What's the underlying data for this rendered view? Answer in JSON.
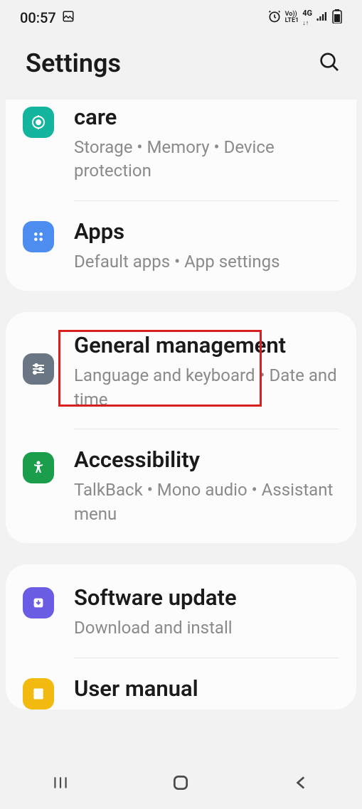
{
  "status_bar": {
    "time": "00:57",
    "icons": {
      "picture": "picture-icon",
      "alarm": "alarm-icon",
      "volte": "Vo))\nLTE1",
      "network": "4G",
      "arrows": "↓↑",
      "signal": "signal-icon",
      "battery": "battery-icon"
    }
  },
  "header": {
    "title": "Settings"
  },
  "groups": [
    {
      "items": [
        {
          "icon": "care-icon",
          "icon_color": "#14b59e",
          "title": "care",
          "subtitle": "Storage  •  Memory  •  Device protection"
        },
        {
          "icon": "apps-icon",
          "icon_color": "#4d8def",
          "title": "Apps",
          "subtitle": "Default apps  •  App settings"
        }
      ]
    },
    {
      "items": [
        {
          "icon": "sliders-icon",
          "icon_color": "#6b7684",
          "title": "General management",
          "subtitle": "Language and keyboard  •  Date and time",
          "highlighted": true
        },
        {
          "icon": "accessibility-icon",
          "icon_color": "#1a9e4b",
          "title": "Accessibility",
          "subtitle": "TalkBack  •  Mono audio  •  Assistant menu"
        }
      ]
    },
    {
      "items": [
        {
          "icon": "download-icon",
          "icon_color": "#6a5de3",
          "title": "Software update",
          "subtitle": "Download and install"
        },
        {
          "icon": "book-icon",
          "icon_color": "#f2b90f",
          "title": "User manual",
          "subtitle": ""
        }
      ]
    }
  ],
  "nav": {
    "recent": "recent-apps",
    "home": "home",
    "back": "back"
  }
}
